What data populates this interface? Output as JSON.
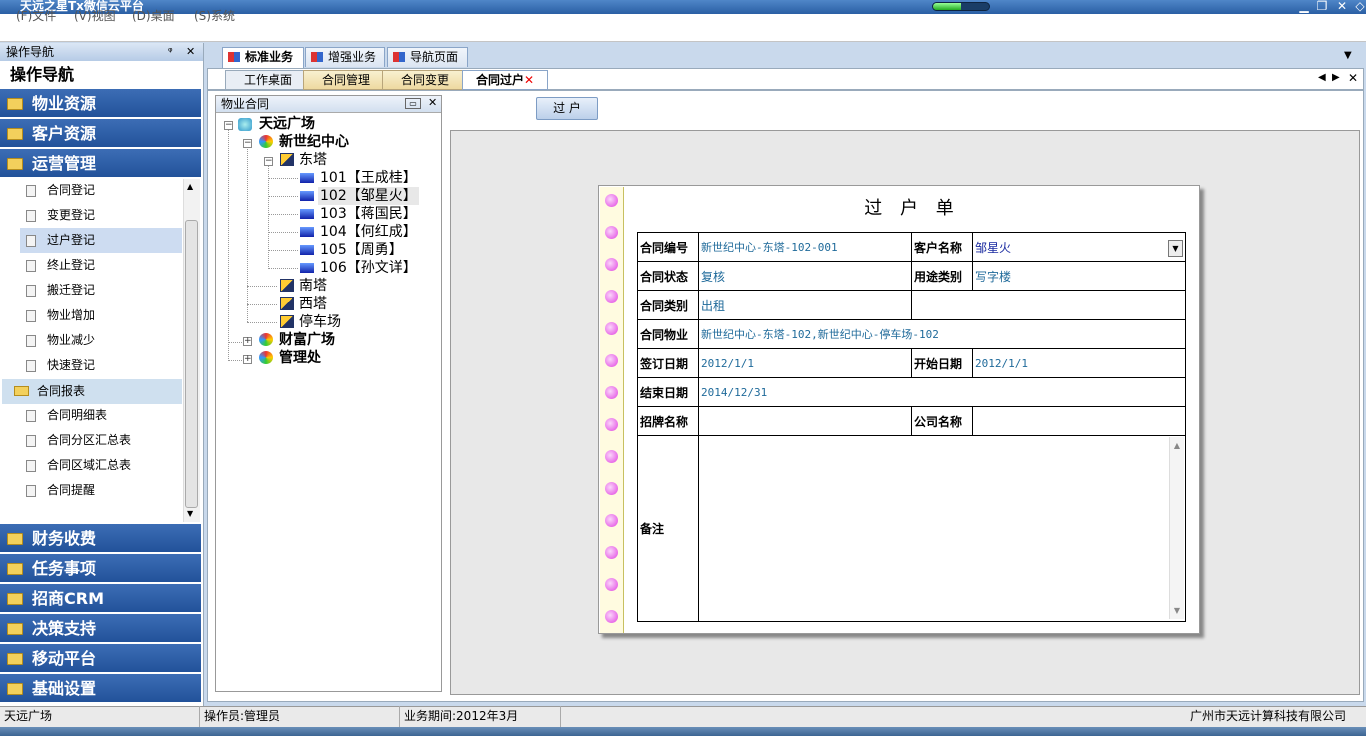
{
  "window": {
    "title": "天远之星Tx微信云平台",
    "progress": 0.5
  },
  "menu": {
    "file": "(F)文件",
    "view": "(V)视图",
    "desktop": "(D)桌面",
    "system": "(S)系统"
  },
  "nav": {
    "header": "操作导航",
    "pin": "ᵠ",
    "close": "✕",
    "title": "操作导航",
    "groups_top": [
      "物业资源",
      "客户资源",
      "运营管理"
    ],
    "items": [
      "合同登记",
      "变更登记",
      "过户登记",
      "终止登记",
      "搬迁登记",
      "物业增加",
      "物业减少",
      "快速登记"
    ],
    "report_folder": "合同报表",
    "report_items": [
      "合同明细表",
      "合同分区汇总表",
      "合同区域汇总表",
      "合同提醒"
    ],
    "groups_bottom": [
      "财务收费",
      "任务事项",
      "招商CRM",
      "决策支持",
      "移动平台",
      "基础设置"
    ]
  },
  "tabs": {
    "top": [
      "标准业务",
      "增强业务",
      "导航页面"
    ],
    "inner": [
      "工作桌面",
      "合同管理",
      "合同变更",
      "合同过户"
    ],
    "inner_close": "✕"
  },
  "tree": {
    "header": "物业合同",
    "root": "天远广场",
    "center": "新世纪中心",
    "east": "东塔",
    "units": [
      "101【王成桂】",
      "102【邹星火】",
      "103【蒋国民】",
      "104【何红成】",
      "105【周勇】",
      "106【孙文详】"
    ],
    "south": "南塔",
    "west": "西塔",
    "parking": "停车场",
    "wealth": "财富广场",
    "mgmt": "管理处"
  },
  "action": {
    "transfer_button": "过 户"
  },
  "form": {
    "title": "过 户 单",
    "labels": {
      "contract_no": "合同编号",
      "customer": "客户名称",
      "status": "合同状态",
      "usage": "用途类别",
      "ctype": "合同类别",
      "property": "合同物业",
      "sign_date": "签订日期",
      "start_date": "开始日期",
      "end_date": "结束日期",
      "brand": "招牌名称",
      "company": "公司名称",
      "remark": "备注"
    },
    "values": {
      "contract_no": "新世纪中心-东塔-102-001",
      "customer": "邹星火",
      "status": "复核",
      "usage": "写字楼",
      "ctype": "出租",
      "property": "新世纪中心-东塔-102,新世纪中心-停车场-102",
      "sign_date": "2012/1/1",
      "start_date": "2012/1/1",
      "end_date": "2014/12/31",
      "brand": "",
      "company": ""
    }
  },
  "status": {
    "site": "天远广场",
    "operator": "操作员:管理员",
    "period": "业务期间:2012年3月",
    "company": "广州市天远计算科技有限公司"
  }
}
